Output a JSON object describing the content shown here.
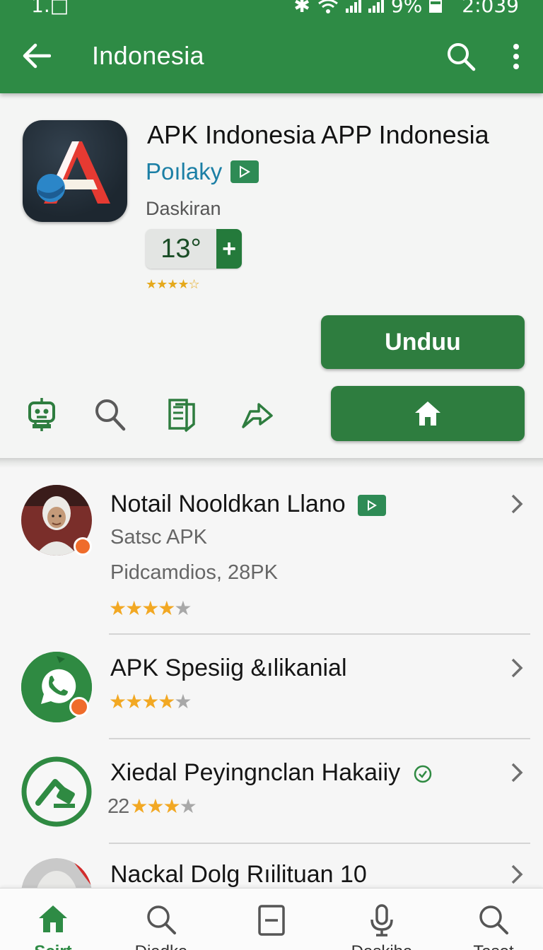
{
  "status_bar": {
    "left_text": "1.□",
    "battery": "9%",
    "time": "2:039"
  },
  "toolbar": {
    "title": "Indonesia",
    "back_icon": "arrow-left-icon",
    "search_icon": "search-icon",
    "more_icon": "more-vert-icon"
  },
  "app": {
    "name": "APK Indonesia APP Indonesia",
    "developer": "Poılaky",
    "category": "Daskiran",
    "rating_value": "13°",
    "rating_plus": "+",
    "mini_stars": "★★★★☆",
    "download_label": "Unduu",
    "accent_color": "#2e8b45"
  },
  "actions": [
    {
      "icon": "robot-icon"
    },
    {
      "icon": "search-icon"
    },
    {
      "icon": "documents-icon"
    },
    {
      "icon": "share-icon"
    }
  ],
  "list": [
    {
      "title": "Notail Nooldkan Llano",
      "subtitle": "Satsc APK",
      "meta": "Pidcamdios, 28PK",
      "stars_on": "★★★★",
      "stars_off": "★",
      "rating_prefix": ""
    },
    {
      "title": "APK Spesiig &ılikanial",
      "stars_on": "★★★★",
      "stars_off": "★",
      "rating_prefix": ""
    },
    {
      "title": "Xiedal Peyingnclan Hakaiiy",
      "stars_on": "★★★",
      "stars_off": "★",
      "rating_prefix": "22"
    },
    {
      "title": "Nackal Dolg Rıilituan 10"
    }
  ],
  "bottom_nav": [
    {
      "label": "Scirt",
      "icon": "home-icon"
    },
    {
      "label": "Diadka",
      "icon": "search-icon"
    },
    {
      "label": "",
      "icon": "minus-box-icon"
    },
    {
      "label": "Daskiha",
      "icon": "microphone-icon"
    },
    {
      "label": "Taset",
      "icon": "search-icon"
    }
  ]
}
